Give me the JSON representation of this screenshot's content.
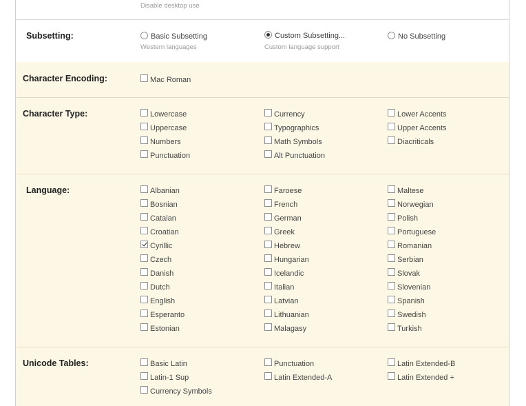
{
  "top_note": "Disable desktop use",
  "subsetting": {
    "label": "Subsetting:",
    "options": [
      {
        "label": "Basic Subsetting",
        "note": "Western languages",
        "selected": false
      },
      {
        "label": "Custom Subsetting...",
        "note": "Custom language support",
        "selected": true
      },
      {
        "label": "No Subsetting",
        "note": "",
        "selected": false
      }
    ]
  },
  "encoding": {
    "label": "Character Encoding:",
    "items": [
      {
        "label": "Mac Roman",
        "checked": false
      }
    ]
  },
  "char_type": {
    "label": "Character Type:",
    "items": [
      {
        "label": "Lowercase",
        "checked": false
      },
      {
        "label": "Uppercase",
        "checked": false
      },
      {
        "label": "Numbers",
        "checked": false
      },
      {
        "label": "Punctuation",
        "checked": false
      },
      {
        "label": "Currency",
        "checked": false
      },
      {
        "label": "Typographics",
        "checked": false
      },
      {
        "label": "Math Symbols",
        "checked": false
      },
      {
        "label": "Alt Punctuation",
        "checked": false
      },
      {
        "label": "Lower Accents",
        "checked": false
      },
      {
        "label": "Upper Accents",
        "checked": false
      },
      {
        "label": "Diacriticals",
        "checked": false
      }
    ]
  },
  "language": {
    "label": "Language:",
    "items": [
      {
        "label": "Albanian",
        "checked": false
      },
      {
        "label": "Bosnian",
        "checked": false
      },
      {
        "label": "Catalan",
        "checked": false
      },
      {
        "label": "Croatian",
        "checked": false
      },
      {
        "label": "Cyrillic",
        "checked": true
      },
      {
        "label": "Czech",
        "checked": false
      },
      {
        "label": "Danish",
        "checked": false
      },
      {
        "label": "Dutch",
        "checked": false
      },
      {
        "label": "English",
        "checked": false
      },
      {
        "label": "Esperanto",
        "checked": false
      },
      {
        "label": "Estonian",
        "checked": false
      },
      {
        "label": "Faroese",
        "checked": false
      },
      {
        "label": "French",
        "checked": false
      },
      {
        "label": "German",
        "checked": false
      },
      {
        "label": "Greek",
        "checked": false
      },
      {
        "label": "Hebrew",
        "checked": false
      },
      {
        "label": "Hungarian",
        "checked": false
      },
      {
        "label": "Icelandic",
        "checked": false
      },
      {
        "label": "Italian",
        "checked": false
      },
      {
        "label": "Latvian",
        "checked": false
      },
      {
        "label": "Lithuanian",
        "checked": false
      },
      {
        "label": "Malagasy",
        "checked": false
      },
      {
        "label": "Maltese",
        "checked": false
      },
      {
        "label": "Norwegian",
        "checked": false
      },
      {
        "label": "Polish",
        "checked": false
      },
      {
        "label": "Portuguese",
        "checked": false
      },
      {
        "label": "Romanian",
        "checked": false
      },
      {
        "label": "Serbian",
        "checked": false
      },
      {
        "label": "Slovak",
        "checked": false
      },
      {
        "label": "Slovenian",
        "checked": false
      },
      {
        "label": "Spanish",
        "checked": false
      },
      {
        "label": "Swedish",
        "checked": false
      },
      {
        "label": "Turkish",
        "checked": false
      }
    ]
  },
  "unicode": {
    "label": "Unicode Tables:",
    "items": [
      {
        "label": "Basic Latin",
        "checked": false
      },
      {
        "label": "Latin-1 Sup",
        "checked": false
      },
      {
        "label": "Currency Symbols",
        "checked": false
      },
      {
        "label": "Punctuation",
        "checked": false
      },
      {
        "label": "Latin Extended-A",
        "checked": false
      },
      {
        "label": "Latin Extended-B",
        "checked": false
      },
      {
        "label": "Latin Extended +",
        "checked": false
      }
    ]
  }
}
